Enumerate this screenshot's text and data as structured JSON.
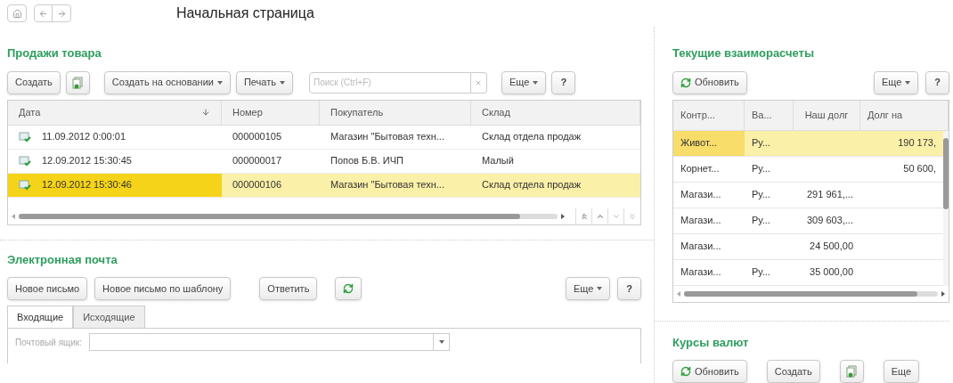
{
  "header": {
    "title": "Начальная страница"
  },
  "sales": {
    "title": "Продажи товара",
    "buttons": [
      {
        "kind": "text",
        "label": "Создать"
      },
      {
        "kind": "copy"
      },
      {
        "kind": "dropdown",
        "label": "Создать на основании"
      },
      {
        "kind": "dropdown",
        "label": "Печать"
      }
    ],
    "search": {
      "placeholder": "Поиск (Ctrl+F)"
    },
    "more": "Еще",
    "help": "?",
    "columns": [
      "Дата",
      "Номер",
      "Покупатель",
      "Склад"
    ],
    "rows": [
      {
        "date": "11.09.2012 0:00:01",
        "number": "000000105",
        "buyer": "Магазин \"Бытовая техн...",
        "warehouse": "Склад отдела продаж",
        "selected": false
      },
      {
        "date": "12.09.2012 15:30:45",
        "number": "000000017",
        "buyer": "Попов Б.В. ИЧП",
        "warehouse": "Малый",
        "selected": false
      },
      {
        "date": "12.09.2012 15:30:46",
        "number": "000000106",
        "buyer": "Магазин \"Бытовая техн...",
        "warehouse": "Склад отдела продаж",
        "selected": true
      }
    ]
  },
  "email": {
    "title": "Электронная почта",
    "buttons": [
      {
        "kind": "text",
        "label": "Новое письмо"
      },
      {
        "kind": "text",
        "label": "Новое письмо по шаблону"
      },
      {
        "kind": "text",
        "label": "Ответить"
      },
      {
        "kind": "refresh"
      }
    ],
    "more": "Еще",
    "help": "?",
    "tabs": [
      {
        "label": "Входящие",
        "selected": true
      },
      {
        "label": "Исходящие",
        "selected": false
      }
    ],
    "mailbox": {
      "label": "Почтовый ящик:"
    }
  },
  "settlements": {
    "title": "Текущие взаиморасчеты",
    "buttons": [
      {
        "kind": "refresh",
        "label": "Обновить"
      }
    ],
    "more": "Еще",
    "help": "?",
    "columns": [
      "Контр...",
      "Ва...",
      "Наш долг",
      "Долг на"
    ],
    "rows": [
      {
        "cells": [
          "Живот...",
          "Ру...",
          "",
          "190 173,"
        ],
        "selected": true
      },
      {
        "cells": [
          "Корнет...",
          "Ру...",
          "",
          "50 600,"
        ],
        "selected": false
      },
      {
        "cells": [
          "Магази...",
          "Ру...",
          "291 961,...",
          ""
        ],
        "selected": false
      },
      {
        "cells": [
          "Магази...",
          "Ру...",
          "309 603,...",
          ""
        ],
        "selected": false
      },
      {
        "cells": [
          "Магази...",
          "",
          "24 500,00",
          ""
        ],
        "selected": false
      },
      {
        "cells": [
          "Магази...",
          "Ру...",
          "35 000,00",
          ""
        ],
        "selected": false
      }
    ]
  },
  "currency": {
    "title": "Курсы валют",
    "buttons": [
      {
        "kind": "refresh",
        "label": "Обновить"
      },
      {
        "kind": "text",
        "label": "Создать"
      },
      {
        "kind": "copy"
      },
      {
        "kind": "text",
        "label": "Еще"
      }
    ]
  }
}
